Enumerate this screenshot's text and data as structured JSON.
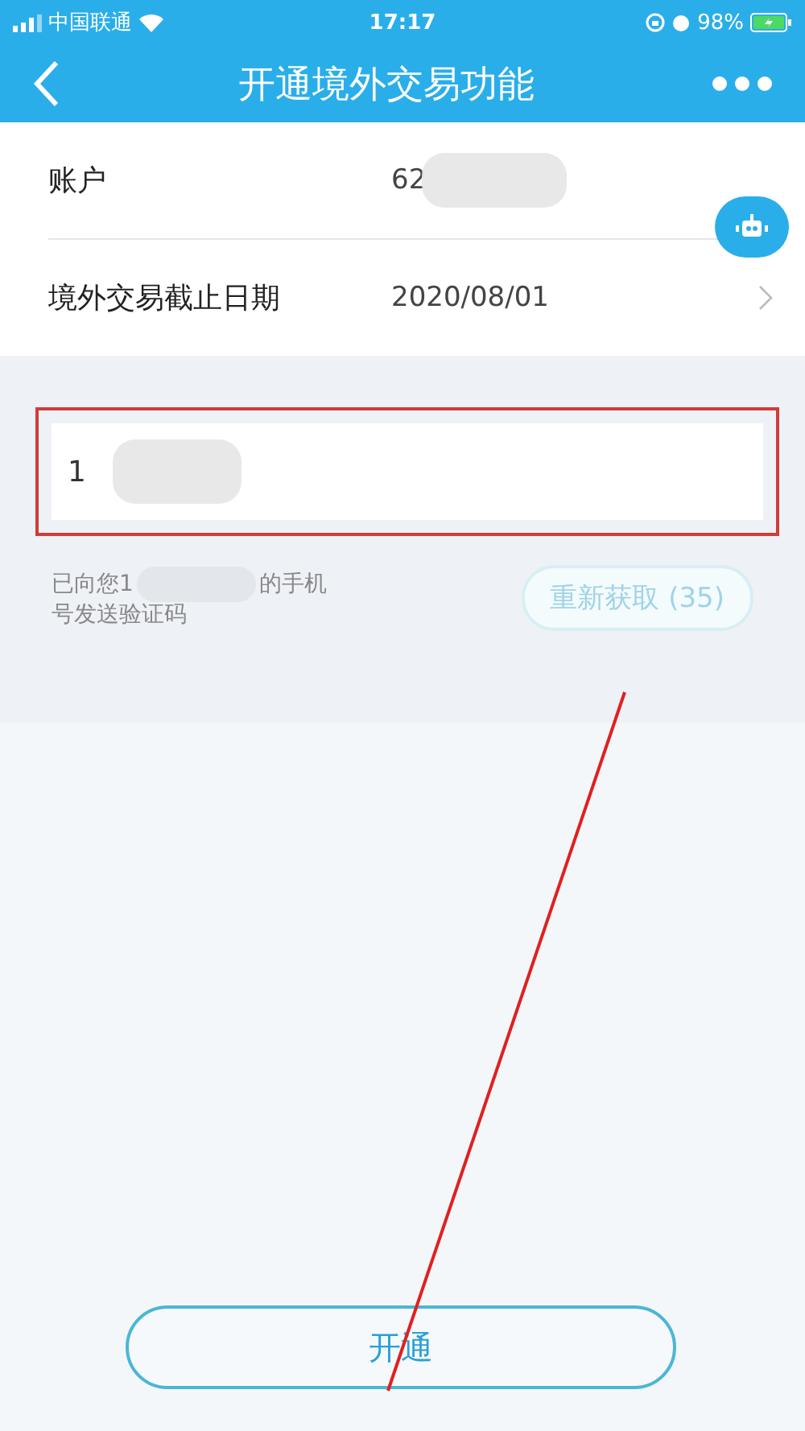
{
  "status_bar": {
    "carrier": "中国联通",
    "time": "17:17",
    "battery": "98%"
  },
  "nav": {
    "title": "开通境外交易功能"
  },
  "rows": [
    {
      "label": "账户",
      "value": "62",
      "masked": true,
      "chevron": false
    },
    {
      "label": "境外交易截止日期",
      "value": "2020/08/01",
      "masked": false,
      "chevron": true
    }
  ],
  "code_field": {
    "value": "1",
    "masked": true,
    "highlighted": true
  },
  "sms_note": {
    "before": "已向您1",
    "after": "的手机",
    "line2": "号发送验证码"
  },
  "resend_button": "重新获取 (35)",
  "submit_button": "开通",
  "annotation_arrow": true
}
